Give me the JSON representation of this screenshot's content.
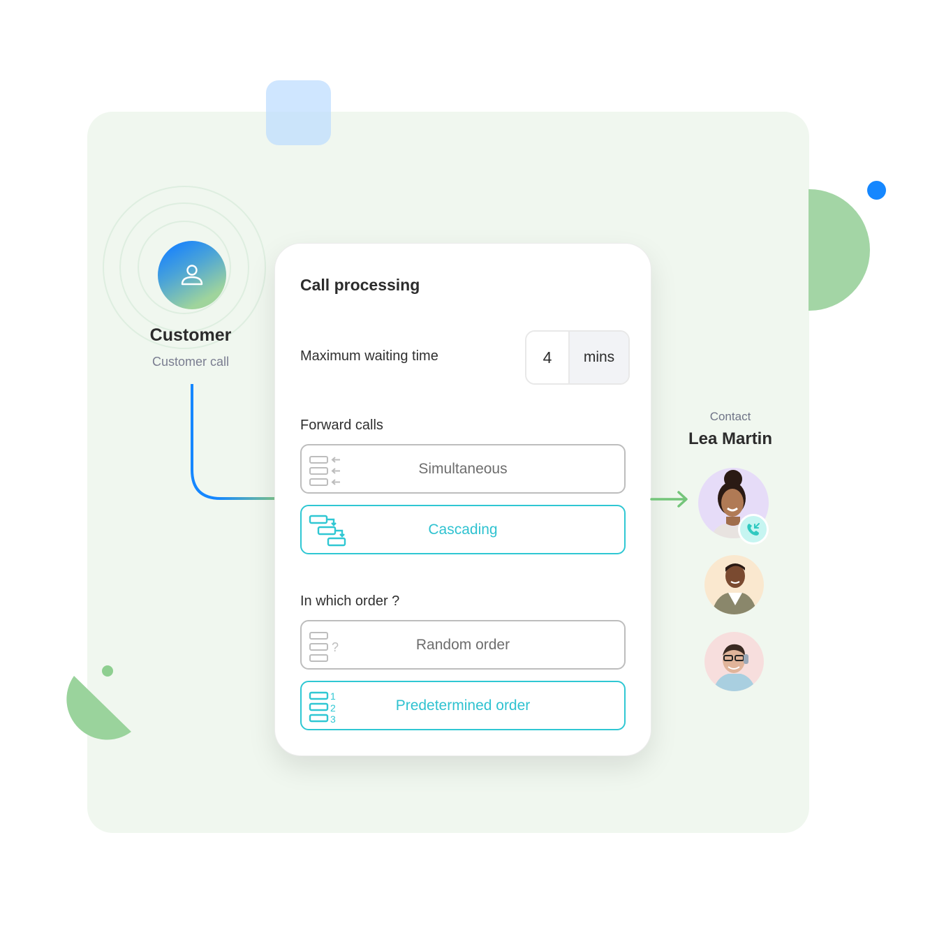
{
  "customer": {
    "title": "Customer",
    "subtitle": "Customer call",
    "icon": "user-icon"
  },
  "card": {
    "title": "Call processing",
    "max_wait": {
      "label": "Maximum waiting time",
      "value": "4",
      "unit": "mins"
    },
    "forward": {
      "label": "Forward calls",
      "options": [
        {
          "label": "Simultaneous",
          "icon": "simultaneous-icon",
          "selected": false
        },
        {
          "label": "Cascading",
          "icon": "cascading-icon",
          "selected": true
        }
      ]
    },
    "order": {
      "label": "In which order ?",
      "options": [
        {
          "label": "Random order",
          "icon": "random-order-icon",
          "selected": false
        },
        {
          "label": "Predetermined order",
          "icon": "predetermined-order-icon",
          "selected": true
        }
      ]
    }
  },
  "contact": {
    "label": "Contact",
    "name": "Lea Martin",
    "avatars": [
      "woman-avatar",
      "man-avatar",
      "headset-man-avatar"
    ],
    "badge_icon": "incoming-call-icon"
  },
  "colors": {
    "accent": "#2fc7d3",
    "inactive": "#bdbdbd",
    "panel_bg": "#f0f7ef",
    "green": "#a3d5a5",
    "blue": "#1587ff"
  }
}
